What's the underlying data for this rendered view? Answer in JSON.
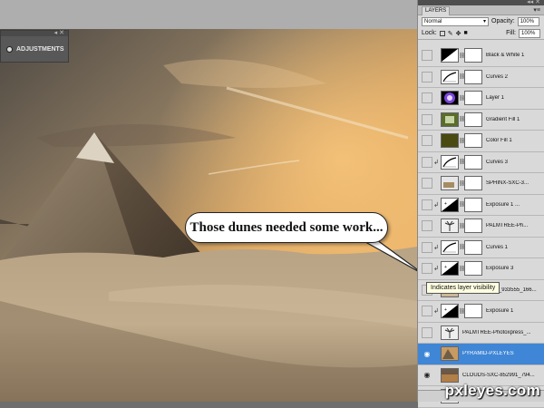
{
  "canvas": {
    "adjustments_title": "ADJUSTMENTS",
    "bubble_text": "Those dunes needed some work..."
  },
  "layers_panel": {
    "tab_label": "LAYERS",
    "blend_mode": "Normal",
    "opacity_label": "Opacity:",
    "opacity_value": "100%",
    "lock_label": "Lock:",
    "fill_label": "Fill:",
    "fill_value": "100%",
    "layers": [
      {
        "name": "Black & White 1",
        "visible": false,
        "clipped": false,
        "thumb": "adjustment-bw",
        "mask": true,
        "selected": false,
        "italic": false
      },
      {
        "name": "Curves 2",
        "visible": false,
        "clipped": false,
        "thumb": "adjustment-curves",
        "mask": true,
        "selected": false,
        "italic": false
      },
      {
        "name": "Layer 1",
        "visible": false,
        "clipped": false,
        "thumb": "purple-glow",
        "mask": true,
        "selected": false,
        "italic": false
      },
      {
        "name": "Gradient Fill 1",
        "visible": false,
        "clipped": false,
        "thumb": "gradient-fill",
        "mask": true,
        "selected": false,
        "italic": false
      },
      {
        "name": "Color Fill 1",
        "visible": false,
        "clipped": false,
        "thumb": "olive-fill",
        "mask": true,
        "selected": false,
        "italic": false
      },
      {
        "name": "Curves 3",
        "visible": false,
        "clipped": true,
        "thumb": "adjustment-curves",
        "mask": true,
        "selected": false,
        "italic": false
      },
      {
        "name": "SPHINX-SXC-3...",
        "visible": false,
        "clipped": false,
        "thumb": "sphinx",
        "mask": true,
        "selected": false,
        "italic": false
      },
      {
        "name": "Exposure 1 ...",
        "visible": false,
        "clipped": true,
        "thumb": "adjustment-exposure",
        "mask": true,
        "selected": false,
        "italic": false
      },
      {
        "name": "PALMTREE-Ph...",
        "visible": false,
        "clipped": false,
        "thumb": "palmtree",
        "mask": true,
        "selected": false,
        "italic": false
      },
      {
        "name": "Curves 1",
        "visible": false,
        "clipped": true,
        "thumb": "adjustment-curves",
        "mask": true,
        "selected": false,
        "italic": false
      },
      {
        "name": "Exposure 3",
        "visible": false,
        "clipped": true,
        "thumb": "adjustment-exposure",
        "mask": true,
        "selected": false,
        "italic": false
      },
      {
        "name": "DESERT_SXC_933555_166...",
        "visible": false,
        "clipped": false,
        "thumb": "desert",
        "mask": false,
        "selected": false,
        "italic": false
      },
      {
        "name": "Exposure 1",
        "visible": false,
        "clipped": true,
        "thumb": "adjustment-exposure",
        "mask": true,
        "selected": false,
        "italic": false
      },
      {
        "name": "PALMTREE-Photoxpress_...",
        "visible": false,
        "clipped": false,
        "thumb": "palmtree",
        "mask": false,
        "selected": false,
        "italic": false
      },
      {
        "name": "PYRAMID-PXLEYES",
        "visible": true,
        "clipped": false,
        "thumb": "pyramid",
        "mask": false,
        "selected": true,
        "italic": false
      },
      {
        "name": "CLOUDS-SXC-852991_794...",
        "visible": true,
        "clipped": false,
        "thumb": "clouds",
        "mask": false,
        "selected": false,
        "italic": false
      },
      {
        "name": "Background",
        "visible": true,
        "clipped": false,
        "thumb": "white",
        "mask": false,
        "selected": false,
        "italic": true,
        "locked": true
      }
    ]
  },
  "tooltip": "Indicates layer visibility",
  "watermark": "pxleyes.com",
  "colors": {
    "selection_blue": "#3f86d6",
    "panel_gray": "#d9d9d9",
    "sky_orange": "#e7a65a",
    "sand": "#b9a383"
  }
}
